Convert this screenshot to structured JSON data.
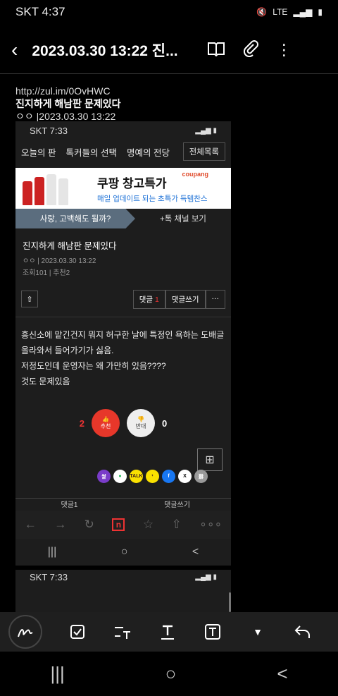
{
  "status_bar": {
    "carrier_time": "SKT 4:37",
    "network": "LTE"
  },
  "header": {
    "title": "2023.03.30 13:22 진...",
    "icons": [
      "back-icon",
      "book-icon",
      "paperclip-icon",
      "more-icon"
    ]
  },
  "note": {
    "url": "http://zul.im/0OvHWC",
    "title": "진지하게 해남판 문제있다",
    "meta": "ㅇㅇ |2023.03.30 13:22"
  },
  "embedded": {
    "status_bar": {
      "carrier_time": "SKT 7:33"
    },
    "tabs": [
      "오늘의 판",
      "톡커들의 선택",
      "명예의 전당"
    ],
    "tabs_all": "전체목록",
    "ad": {
      "title": "쿠팡 창고특가",
      "subtitle": "매일 업데이트 되는 초특가 득템찬스",
      "brand": "coupang"
    },
    "channel": {
      "left": "사랑, 고백해도 될까?",
      "right": "+톡 채널 보기"
    },
    "post": {
      "title": "진지하게 해남판 문제있다",
      "author_date": "ㅇㅇ | 2023.03.30 13:22",
      "stats": "조회101 | 추천2"
    },
    "actions": {
      "comment": "댓글",
      "comment_count": "1",
      "write": "댓글쓰기",
      "more": "···"
    },
    "body": [
      "흥신소에 맡긴건지 뭐지 허구한 날에 특정인 욕하는 도배글",
      "올라와서 들어가기가 싫음.",
      "저정도인데 운영자는 왜 가만히 있음????",
      "것도 문제있음"
    ],
    "votes": {
      "up_count": "2",
      "up_label": "추천",
      "down_label": "반대",
      "down_count": "0"
    },
    "share": [
      "쌀",
      "",
      "TALK",
      "",
      "f",
      "X",
      ""
    ],
    "comment_bar": [
      "댓글1",
      "댓글쓰기"
    ],
    "browser_nav": [
      "←",
      "→",
      "↻",
      "n",
      "☆",
      "⇧",
      "∘∘∘"
    ],
    "sys_nav": [
      "|||",
      "○",
      "<"
    ]
  },
  "embedded2": {
    "carrier_time": "SKT 7:33"
  },
  "toolbar": [
    "pen-icon",
    "checkbox-icon",
    "text-format-icon",
    "text-underline-icon",
    "text-box-icon",
    "dropdown-icon",
    "undo-icon"
  ],
  "nav": [
    "|||",
    "○",
    "<"
  ]
}
